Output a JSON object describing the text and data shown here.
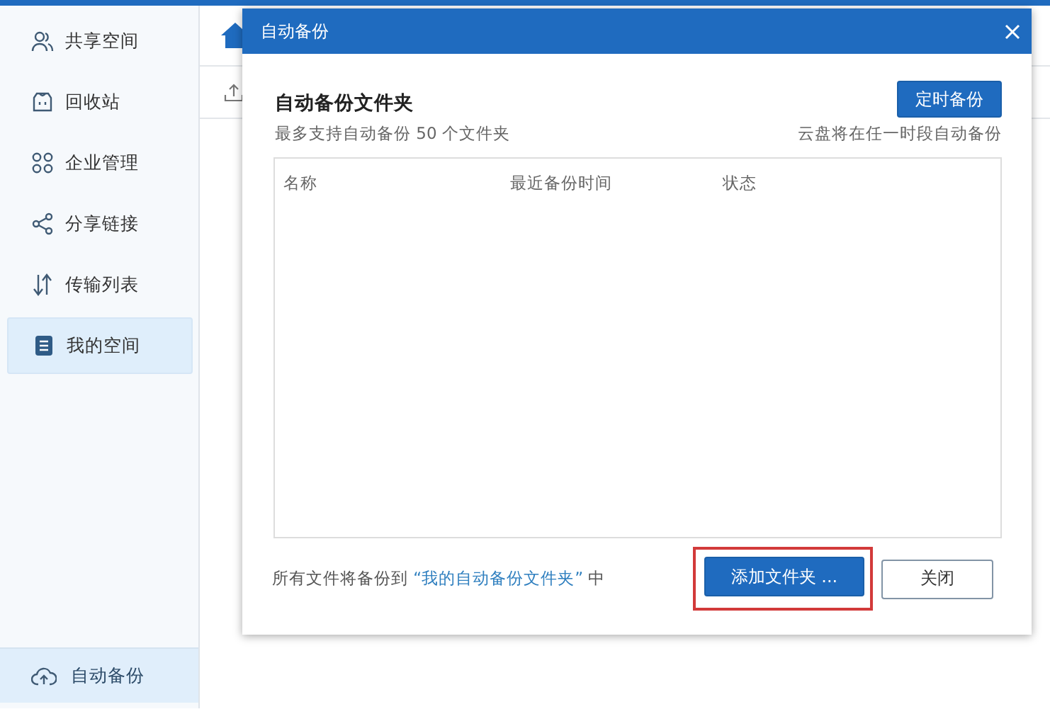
{
  "sidebar": {
    "items": [
      {
        "label": "共享空间",
        "selected": false
      },
      {
        "label": "回收站",
        "selected": false
      },
      {
        "label": "企业管理",
        "selected": false
      },
      {
        "label": "分享链接",
        "selected": false
      },
      {
        "label": "传输列表",
        "selected": false
      },
      {
        "label": "我的空间",
        "selected": true
      }
    ],
    "footer": {
      "label": "自动备份"
    }
  },
  "dialog": {
    "title": "自动备份",
    "heading": "自动备份文件夹",
    "schedule_button": "定时备份",
    "limit_note": "最多支持自动备份 50 个文件夹",
    "schedule_note": "云盘将在任一时段自动备份",
    "table": {
      "columns": [
        "名称",
        "最近备份时间",
        "状态"
      ]
    },
    "footer": {
      "text_before": "所有文件将备份到 ",
      "link": "“我的自动备份文件夹”",
      "text_after": " 中"
    },
    "buttons": [
      {
        "label": "添加文件夹 ...",
        "kind": "primary",
        "highlighted": true
      },
      {
        "label": "关闭",
        "kind": "secondary",
        "highlighted": false
      }
    ]
  }
}
